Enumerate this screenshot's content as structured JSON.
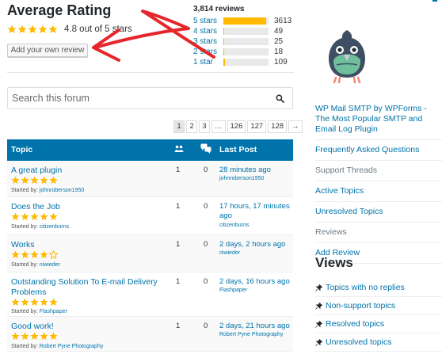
{
  "rating": {
    "title": "Average Rating",
    "stars": 5,
    "text": "4.8 out of 5 stars",
    "add_review_label": "Add your own review"
  },
  "histogram": {
    "total": "3,814 reviews",
    "rows": [
      {
        "label": "5 stars",
        "count": "3613",
        "fraction": 0.947
      },
      {
        "label": "4 stars",
        "count": "49",
        "fraction": 0.013
      },
      {
        "label": "3 stars",
        "count": "25",
        "fraction": 0.007
      },
      {
        "label": "2 stars",
        "count": "18",
        "fraction": 0.005
      },
      {
        "label": "1 star",
        "count": "109",
        "fraction": 0.029
      }
    ]
  },
  "search": {
    "placeholder": "Search this forum"
  },
  "pagination": [
    "1",
    "2",
    "3",
    "…",
    "126",
    "127",
    "128",
    "→"
  ],
  "table": {
    "headers": {
      "topic": "Topic",
      "last_post": "Last Post"
    },
    "rows": [
      {
        "title": "A great plugin",
        "stars": 5,
        "started_by_label": "Started by:",
        "author": "johnroberson1950",
        "voices": "1",
        "posts": "0",
        "last": "28 minutes ago",
        "last_by": "johnroberson1950"
      },
      {
        "title": "Does the Job",
        "stars": 5,
        "started_by_label": "Started by:",
        "author": "citizenburns",
        "voices": "1",
        "posts": "0",
        "last": "17 hours, 17 minutes ago",
        "last_by": "citizenburns"
      },
      {
        "title": "Works",
        "stars": 4,
        "started_by_label": "Started by:",
        "author": "niwieder",
        "voices": "1",
        "posts": "0",
        "last": "2 days, 2 hours ago",
        "last_by": "niwieder"
      },
      {
        "title": "Outstanding Solution To E-mail Delivery Problems",
        "stars": 5,
        "started_by_label": "Started by:",
        "author": "Flashpaper",
        "voices": "1",
        "posts": "0",
        "last": "2 days, 16 hours ago",
        "last_by": "Flashpaper"
      },
      {
        "title": "Good work!",
        "stars": 5,
        "started_by_label": "Started by:",
        "author": "Robert Pyne Photography",
        "voices": "1",
        "posts": "0",
        "last": "2 days, 21 hours ago",
        "last_by": "Robert Pyne Photography"
      }
    ]
  },
  "sidebar": {
    "plugin_name": "WP Mail SMTP by WPForms - The Most Popular SMTP and Email Log Plugin",
    "links": [
      "Frequently Asked Questions",
      "Support Threads",
      "Active Topics",
      "Unresolved Topics",
      "Reviews",
      "Add Review"
    ],
    "views_title": "Views",
    "views": [
      "Topics with no replies",
      "Non-support topics",
      "Resolved topics",
      "Unresolved topics"
    ]
  },
  "colors": {
    "accent": "#0073aa",
    "star": "#ffb900",
    "annotation_arrow": "#e6262b"
  }
}
